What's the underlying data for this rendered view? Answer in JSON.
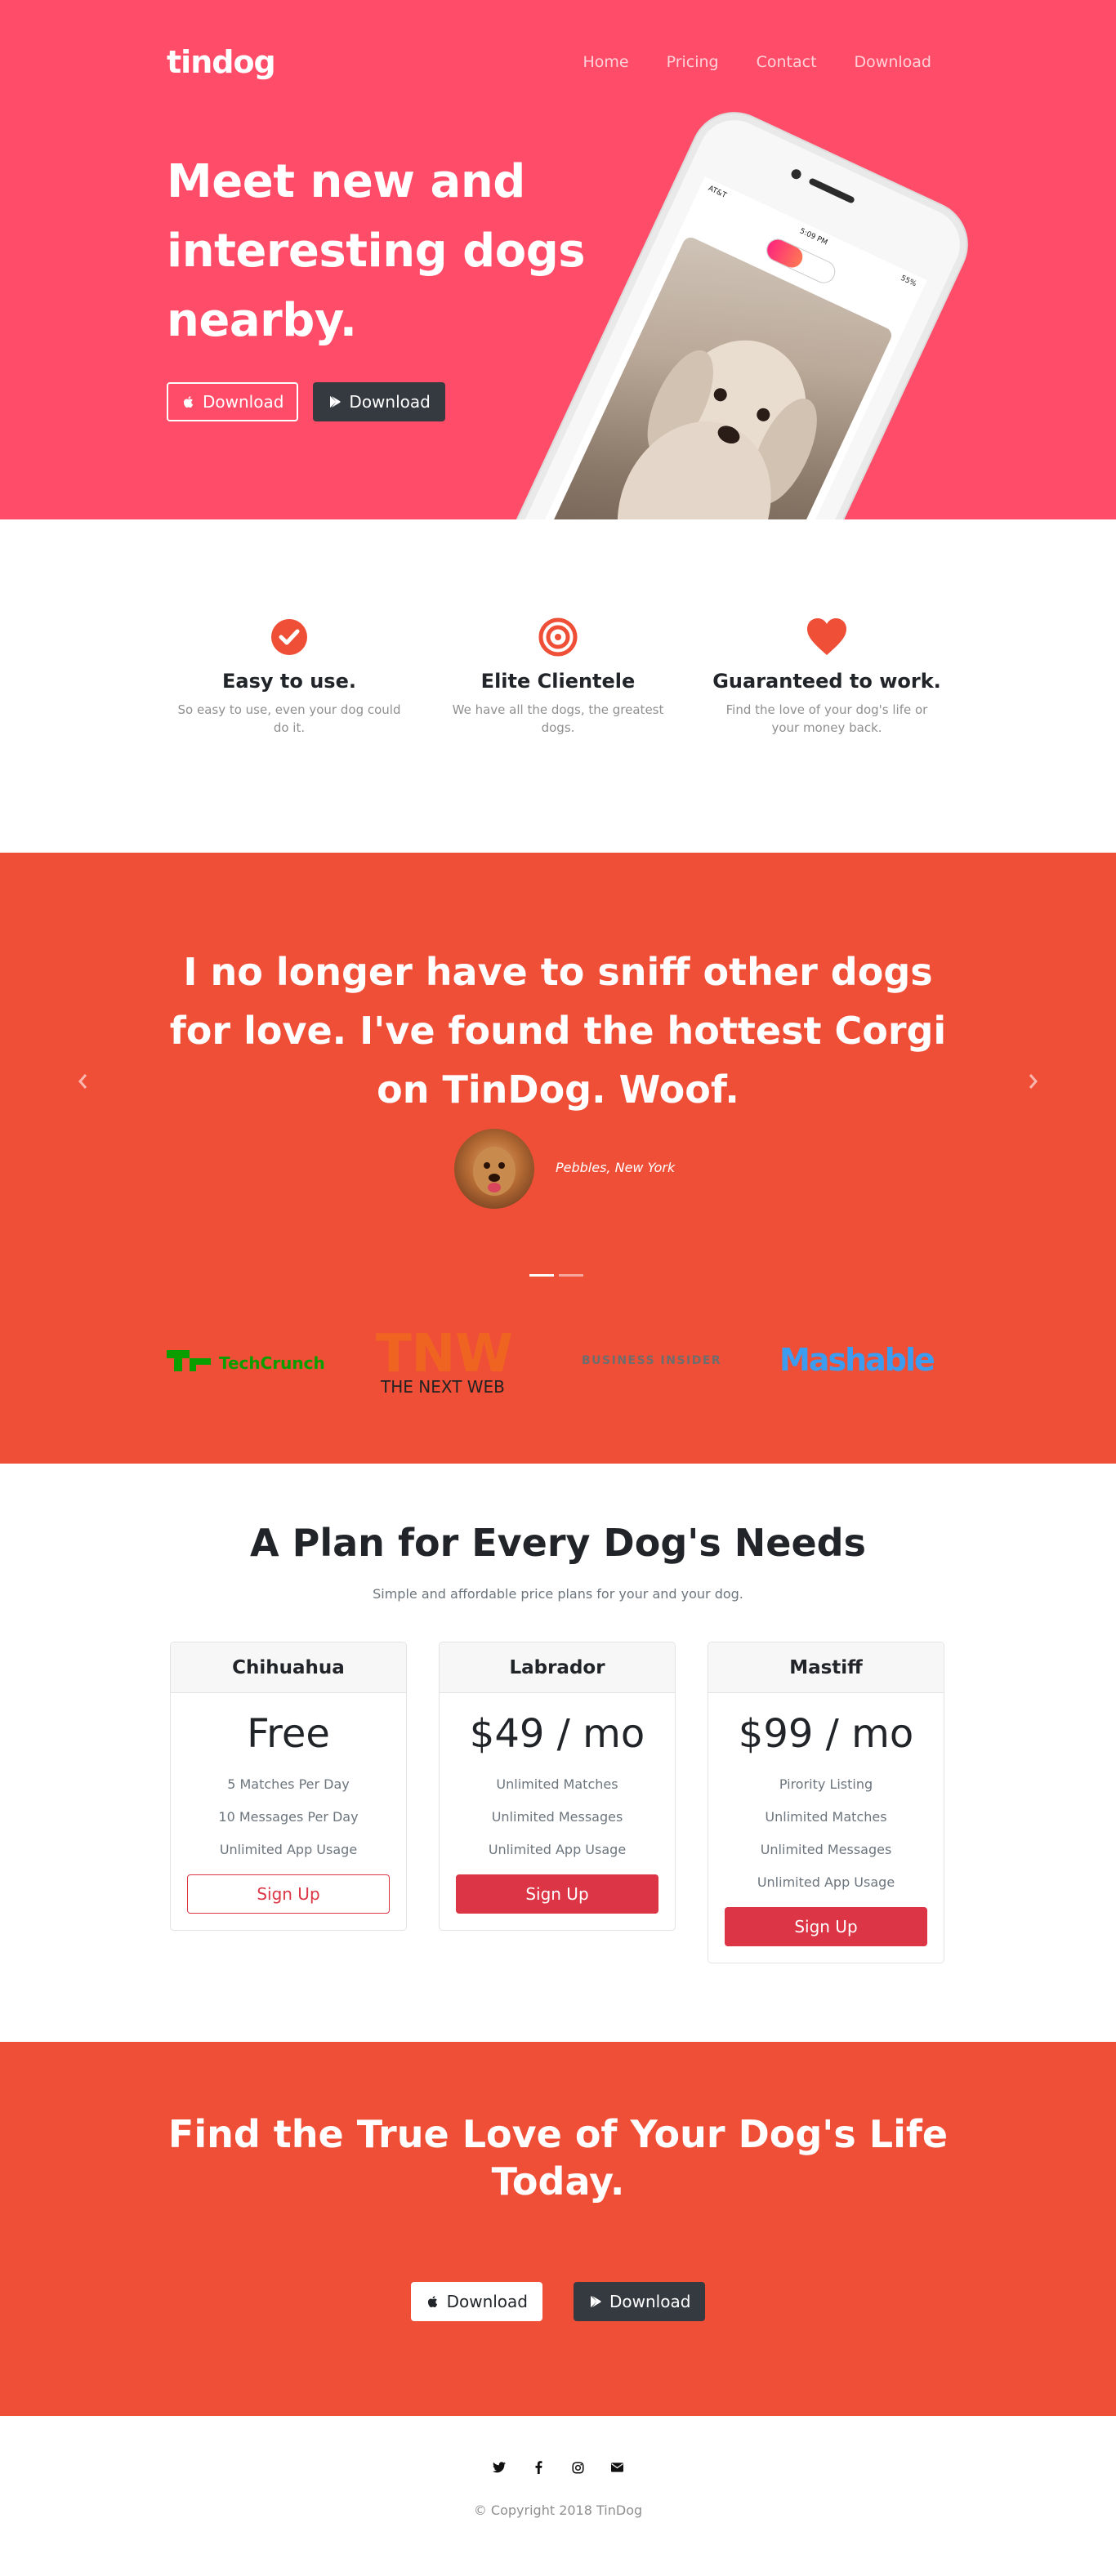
{
  "nav": {
    "brand": "tindog",
    "links": [
      "Home",
      "Pricing",
      "Contact",
      "Download"
    ]
  },
  "hero": {
    "title": "Meet new and interesting dogs nearby.",
    "apple_download": "Download",
    "play_download": "Download",
    "phone_status_left": "AT&T",
    "phone_status_time": "5:09 PM",
    "phone_status_right": "55%"
  },
  "features": [
    {
      "icon": "check-circle-icon",
      "title": "Easy to use.",
      "text": "So easy to use, even your dog could do it."
    },
    {
      "icon": "bullseye-icon",
      "title": "Elite Clientele",
      "text": "We have all the dogs, the greatest dogs."
    },
    {
      "icon": "heart-icon",
      "title": "Guaranteed to work.",
      "text": "Find the love of your dog's life or your money back."
    }
  ],
  "testimonial": {
    "quote": "I no longer have to sniff other dogs for love. I've found the hottest Corgi on TinDog. Woof.",
    "author": "Pebbles, New York"
  },
  "press": [
    "TechCrunch",
    "THE NEXT WEB",
    "BUSINESS INSIDER",
    "Mashable"
  ],
  "pricing": {
    "title": "A Plan for Every Dog's Needs",
    "subtitle": "Simple and affordable price plans for your and your dog.",
    "plans": [
      {
        "name": "Chihuahua",
        "price": "Free",
        "features": [
          "5 Matches Per Day",
          "10 Messages Per Day",
          "Unlimited App Usage"
        ],
        "cta": "Sign Up"
      },
      {
        "name": "Labrador",
        "price": "$49 / mo",
        "features": [
          "Unlimited Matches",
          "Unlimited Messages",
          "Unlimited App Usage"
        ],
        "cta": "Sign Up"
      },
      {
        "name": "Mastiff",
        "price": "$99 / mo",
        "features": [
          "Pirority Listing",
          "Unlimited Matches",
          "Unlimited Messages",
          "Unlimited App Usage"
        ],
        "cta": "Sign Up"
      }
    ]
  },
  "cta": {
    "title": "Find the True Love of Your Dog's Life Today.",
    "apple_download": "Download",
    "play_download": "Download"
  },
  "footer": {
    "socials": [
      "twitter-icon",
      "facebook-icon",
      "instagram-icon",
      "envelope-icon"
    ],
    "copyright": "© Copyright 2018 TinDog"
  },
  "colors": {
    "hero_bg": "#ff4c68",
    "section_bg": "#ef4f37",
    "accent_red": "#dc3545",
    "dark_button": "#343a40"
  }
}
